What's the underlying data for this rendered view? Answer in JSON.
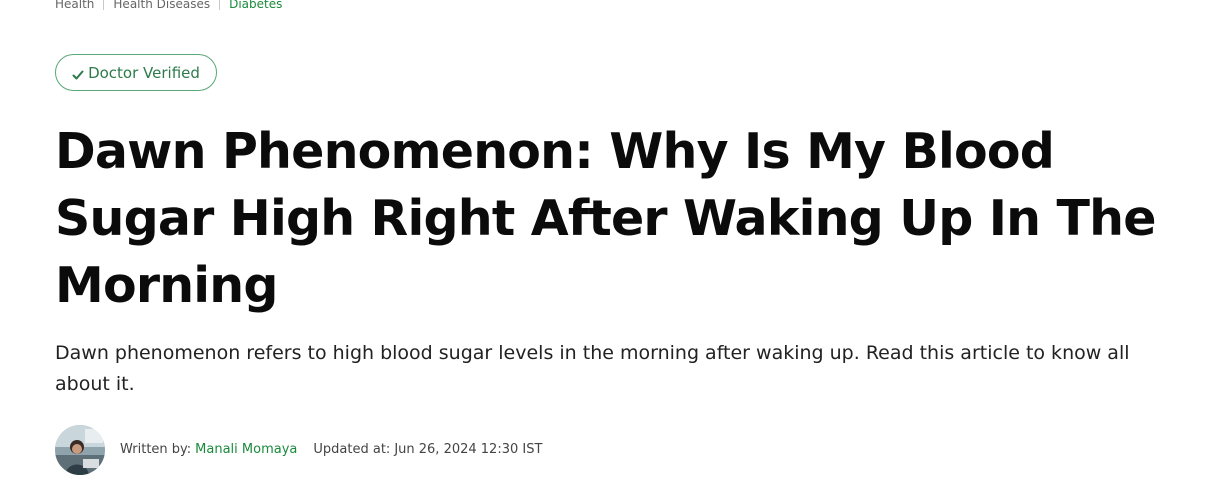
{
  "breadcrumb": {
    "items": [
      "Health",
      "Health Diseases",
      "Diabetes"
    ]
  },
  "badge": {
    "label": "Doctor Verified",
    "icon": "check-icon"
  },
  "article": {
    "title": "Dawn Phenomenon: Why Is My Blood Sugar High Right After Waking Up In The Morning",
    "summary": "Dawn phenomenon refers to high blood sugar levels in the morning after waking up. Read this article to know all about it."
  },
  "byline": {
    "written_by_label": "Written by:",
    "author": "Manali Momaya",
    "updated_label": "Updated at:",
    "updated_value": "Jun 26, 2024 12:30 IST"
  },
  "colors": {
    "accent_green": "#1a8a3c",
    "badge_border": "#5aa777",
    "title": "#0b0b0b"
  }
}
